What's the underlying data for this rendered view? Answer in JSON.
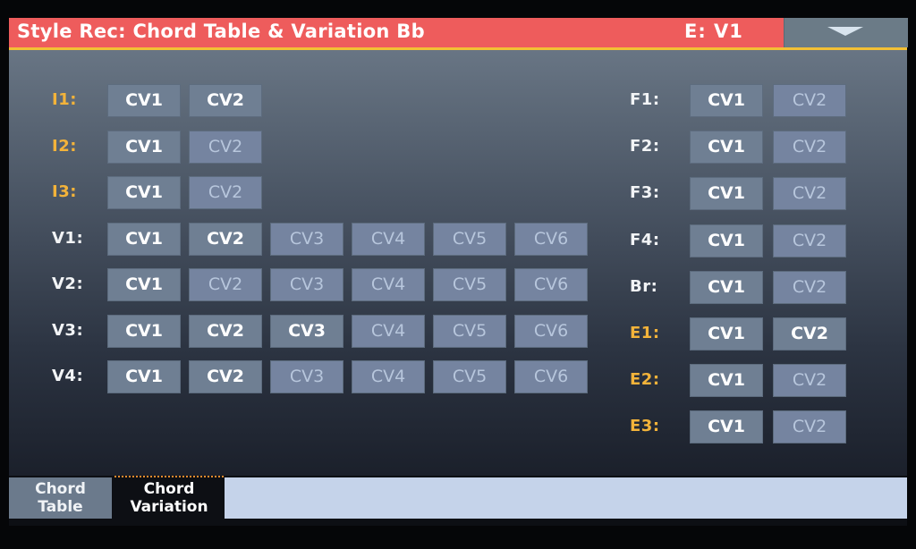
{
  "header": {
    "title": "Style Rec: Chord Table & Variation  Bb",
    "element": "E: V1",
    "menu_icon": "triangle-down-icon"
  },
  "colors": {
    "titlebar": "#ee5c5c",
    "accent_line": "#f2c035",
    "intro_ending_label": "#f3b33a",
    "active_tab_marker": "#e88a2e"
  },
  "left_rows": [
    {
      "label": "I1:",
      "type": "intro",
      "buttons": [
        {
          "label": "CV1",
          "on": true
        },
        {
          "label": "CV2",
          "on": true
        }
      ]
    },
    {
      "label": "I2:",
      "type": "intro",
      "buttons": [
        {
          "label": "CV1",
          "on": true
        },
        {
          "label": "CV2",
          "on": false
        }
      ]
    },
    {
      "label": "I3:",
      "type": "intro",
      "buttons": [
        {
          "label": "CV1",
          "on": true
        },
        {
          "label": "CV2",
          "on": false
        }
      ]
    },
    {
      "label": "V1:",
      "type": "plain",
      "buttons": [
        {
          "label": "CV1",
          "on": true
        },
        {
          "label": "CV2",
          "on": true
        },
        {
          "label": "CV3",
          "on": false
        },
        {
          "label": "CV4",
          "on": false
        },
        {
          "label": "CV5",
          "on": false
        },
        {
          "label": "CV6",
          "on": false
        }
      ]
    },
    {
      "label": "V2:",
      "type": "plain",
      "buttons": [
        {
          "label": "CV1",
          "on": true
        },
        {
          "label": "CV2",
          "on": false
        },
        {
          "label": "CV3",
          "on": false
        },
        {
          "label": "CV4",
          "on": false
        },
        {
          "label": "CV5",
          "on": false
        },
        {
          "label": "CV6",
          "on": false
        }
      ]
    },
    {
      "label": "V3:",
      "type": "plain",
      "buttons": [
        {
          "label": "CV1",
          "on": true
        },
        {
          "label": "CV2",
          "on": true
        },
        {
          "label": "CV3",
          "on": true
        },
        {
          "label": "CV4",
          "on": false
        },
        {
          "label": "CV5",
          "on": false
        },
        {
          "label": "CV6",
          "on": false
        }
      ]
    },
    {
      "label": "V4:",
      "type": "plain",
      "buttons": [
        {
          "label": "CV1",
          "on": true
        },
        {
          "label": "CV2",
          "on": true
        },
        {
          "label": "CV3",
          "on": false
        },
        {
          "label": "CV4",
          "on": false
        },
        {
          "label": "CV5",
          "on": false
        },
        {
          "label": "CV6",
          "on": false
        }
      ]
    }
  ],
  "right_rows": [
    {
      "label": "F1:",
      "type": "plain",
      "buttons": [
        {
          "label": "CV1",
          "on": true
        },
        {
          "label": "CV2",
          "on": false
        }
      ]
    },
    {
      "label": "F2:",
      "type": "plain",
      "buttons": [
        {
          "label": "CV1",
          "on": true
        },
        {
          "label": "CV2",
          "on": false
        }
      ]
    },
    {
      "label": "F3:",
      "type": "plain",
      "buttons": [
        {
          "label": "CV1",
          "on": true
        },
        {
          "label": "CV2",
          "on": false
        }
      ]
    },
    {
      "label": "F4:",
      "type": "plain",
      "buttons": [
        {
          "label": "CV1",
          "on": true
        },
        {
          "label": "CV2",
          "on": false
        }
      ]
    },
    {
      "label": "Br:",
      "type": "plain",
      "buttons": [
        {
          "label": "CV1",
          "on": true
        },
        {
          "label": "CV2",
          "on": false
        }
      ]
    },
    {
      "label": "E1:",
      "type": "ending",
      "buttons": [
        {
          "label": "CV1",
          "on": true
        },
        {
          "label": "CV2",
          "on": true
        }
      ]
    },
    {
      "label": "E2:",
      "type": "ending",
      "buttons": [
        {
          "label": "CV1",
          "on": true
        },
        {
          "label": "CV2",
          "on": false
        }
      ]
    },
    {
      "label": "E3:",
      "type": "ending",
      "buttons": [
        {
          "label": "CV1",
          "on": true
        },
        {
          "label": "CV2",
          "on": false
        }
      ]
    }
  ],
  "tabs": [
    {
      "line1": "Chord",
      "line2": "Table",
      "active": false
    },
    {
      "line1": "Chord",
      "line2": "Variation",
      "active": true
    }
  ]
}
